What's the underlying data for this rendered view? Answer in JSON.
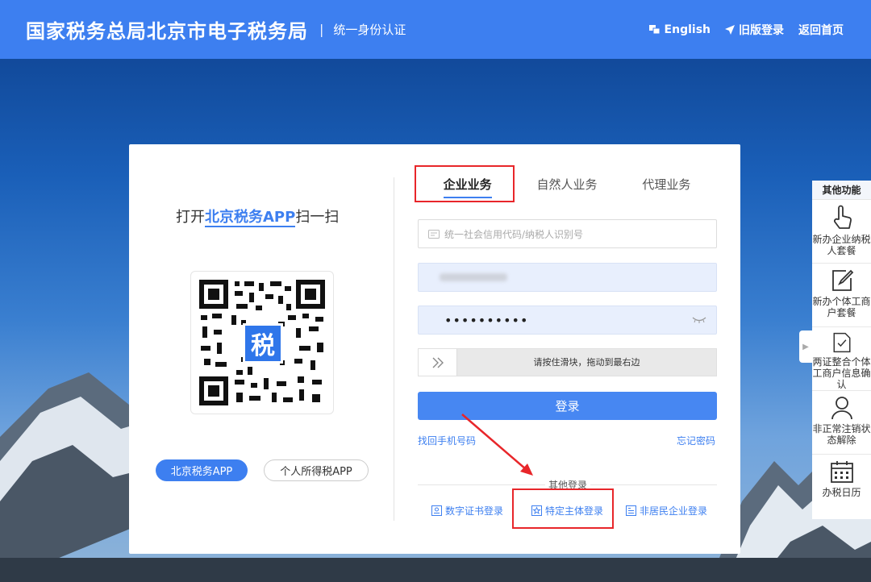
{
  "header": {
    "title": "国家税务总局北京市电子税务局",
    "separator": "|",
    "subtitle": "统一身份认证",
    "links": {
      "english": "English",
      "old_login": "旧版登录",
      "home": "返回首页"
    }
  },
  "left": {
    "prefix": "打开",
    "app_name": "北京税务APP",
    "suffix": "扫一扫",
    "qr_badge": "税",
    "btn_primary": "北京税务APP",
    "btn_secondary": "个人所得税APP"
  },
  "tabs": [
    "企业业务",
    "自然人业务",
    "代理业务"
  ],
  "form": {
    "id_placeholder": "统一社会信用代码/纳税人识别号",
    "password_mask": "••••••••••",
    "slider_text": "请按住滑块，拖动到最右边",
    "login": "登录",
    "find_phone": "找回手机号码",
    "forgot_password": "忘记密码"
  },
  "other_login": {
    "title": "其他登录",
    "items": [
      "数字证书登录",
      "特定主体登录",
      "非居民企业登录"
    ]
  },
  "side_panel": {
    "title": "其他功能",
    "items": [
      "新办企业纳税人套餐",
      "新办个体工商户套餐",
      "两证整合个体工商户信息确认",
      "非正常注销状态解除",
      "办税日历"
    ]
  },
  "colors": {
    "header_bg": "#3d7ff0",
    "accent": "#3d7ff0",
    "highlight_red": "#e8262a"
  }
}
